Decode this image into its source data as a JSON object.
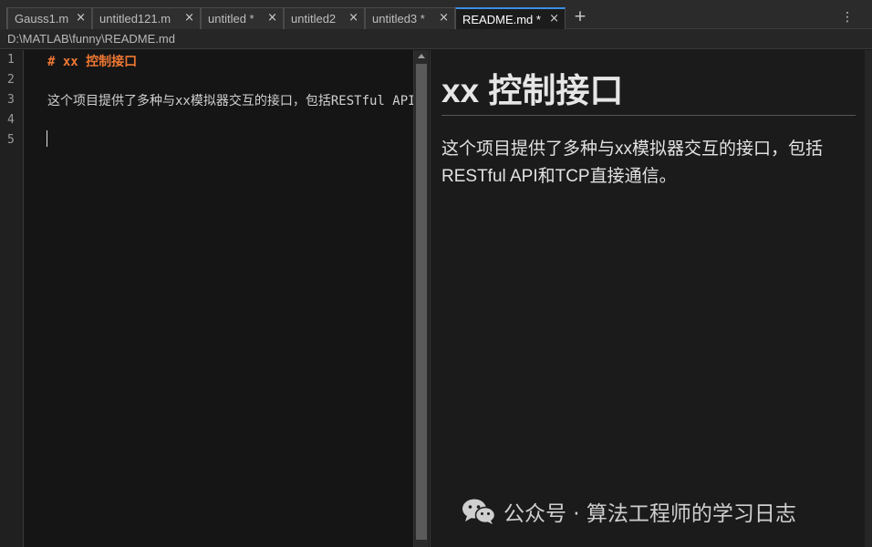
{
  "tabs": [
    {
      "label": "Gauss1.m",
      "close": "×"
    },
    {
      "label": "untitled121.m",
      "close": "×"
    },
    {
      "label": "untitled *",
      "close": "×"
    },
    {
      "label": "untitled2",
      "close": "×"
    },
    {
      "label": "untitled3 *",
      "close": "×"
    },
    {
      "label": "README.md *",
      "close": "×",
      "active": true
    }
  ],
  "tab_add": "+",
  "tab_menu": "⋮",
  "path": "D:\\MATLAB\\funny\\README.md",
  "editor": {
    "line_numbers": [
      "1",
      "2",
      "3",
      "4",
      "5"
    ],
    "lines": [
      "# xx 控制接口",
      "",
      "这个项目提供了多种与xx模拟器交互的接口，包括RESTful API和TCP直接通信。",
      "",
      ""
    ]
  },
  "preview": {
    "heading": "xx 控制接口",
    "paragraph": "这个项目提供了多种与xx模拟器交互的接口，包括RESTful API和TCP直接通信。"
  },
  "watermark": {
    "icon": "wechat-icon",
    "text": "公众号 · 算法工程师的学习日志"
  },
  "colors": {
    "heading_markdown": "#ee7733",
    "active_tab_accent": "#3d8ee6"
  }
}
